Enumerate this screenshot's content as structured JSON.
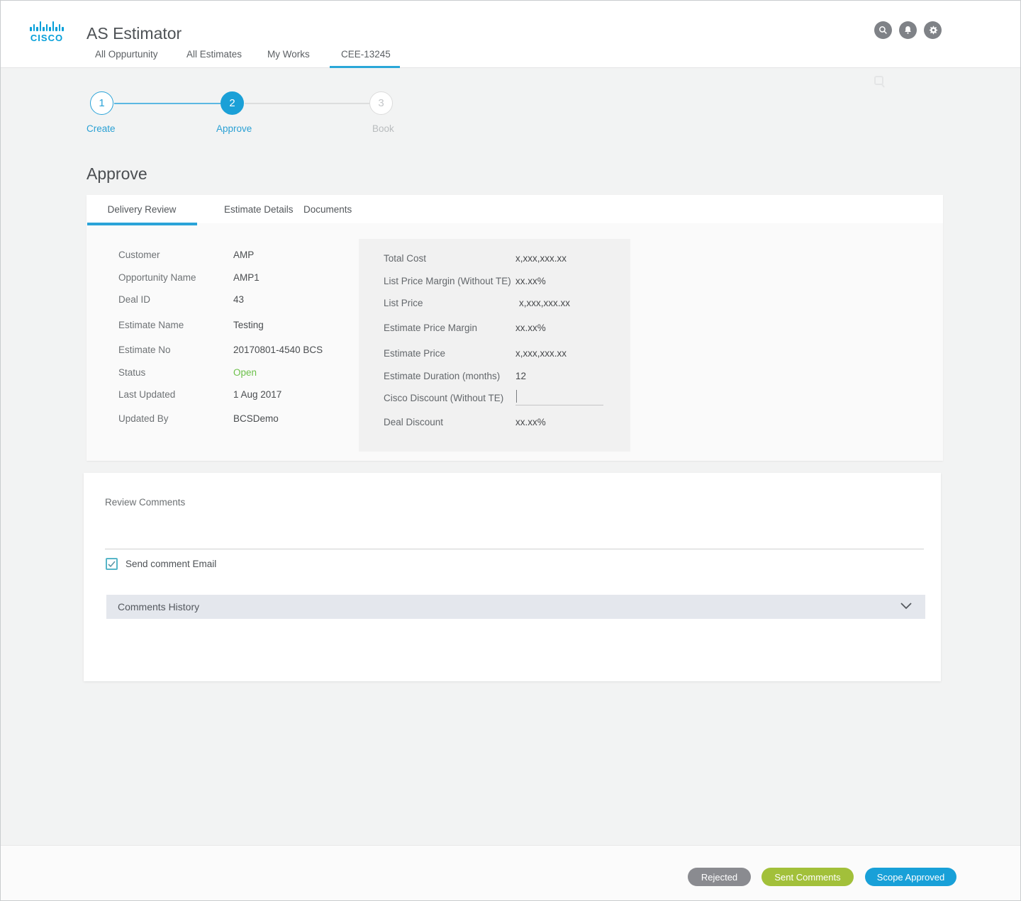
{
  "header": {
    "brand": "CISCO",
    "app_title": "AS Estimator",
    "nav": [
      {
        "label": "All Oppurtunity",
        "active": false
      },
      {
        "label": "All Estimates",
        "active": false
      },
      {
        "label": "My Works",
        "active": false
      },
      {
        "label": "CEE-13245",
        "active": true
      }
    ],
    "icons": [
      "search-icon",
      "bell-icon",
      "gear-icon"
    ]
  },
  "stepper": {
    "steps": [
      {
        "num": "1",
        "label": "Create",
        "state": "done"
      },
      {
        "num": "2",
        "label": "Approve",
        "state": "active"
      },
      {
        "num": "3",
        "label": "Book",
        "state": "upcoming"
      }
    ]
  },
  "page": {
    "title": "Approve"
  },
  "tabs": [
    {
      "label": "Delivery Review",
      "active": true
    },
    {
      "label": "Estimate Details",
      "active": false
    },
    {
      "label": "Documents",
      "active": false
    }
  ],
  "details": {
    "rows": [
      {
        "label": "Customer",
        "value": "AMP"
      },
      {
        "label": "Opportunity Name",
        "value": "AMP1"
      },
      {
        "label": "Deal ID",
        "value": "43"
      },
      {
        "label": "Estimate Name",
        "value": "Testing"
      },
      {
        "label": "Estimate No",
        "value": "20170801-4540 BCS"
      },
      {
        "label": "Status",
        "value": "Open"
      },
      {
        "label": "Last Updated",
        "value": "1 Aug 2017"
      },
      {
        "label": "Updated By",
        "value": "BCSDemo"
      }
    ]
  },
  "pricing": {
    "rows": [
      {
        "label": "Total Cost",
        "value": "x,xxx,xxx.xx"
      },
      {
        "label": "List Price Margin (Without TE)",
        "value": "xx.xx%"
      },
      {
        "label": "List Price",
        "value": "x,xxx,xxx.xx"
      },
      {
        "label": "Estimate Price Margin",
        "value": "xx.xx%"
      },
      {
        "label": "Estimate Price",
        "value": "x,xxx,xxx.xx"
      },
      {
        "label": "Estimate Duration (months)",
        "value": "12"
      },
      {
        "label": "Cisco Discount (Without TE)",
        "value": ""
      },
      {
        "label": "Deal Discount",
        "value": "xx.xx%"
      }
    ],
    "discount_input": {
      "value": "",
      "placeholder": ""
    }
  },
  "comments": {
    "section_label": "Review Comments",
    "comment_value": "",
    "checkbox_label": "Send comment Email",
    "checkbox_checked": true,
    "history_label": "Comments History"
  },
  "footer": {
    "buttons": [
      {
        "label": "Rejected"
      },
      {
        "label": "Sent Comments"
      },
      {
        "label": "Scope Approved"
      }
    ]
  },
  "colors": {
    "accent_blue": "#1ba0d7",
    "cisco_blue": "#049fd9",
    "status_green": "#6cc04a",
    "button_gray": "#8a8b90",
    "button_olive": "#a2c03a",
    "button_blue": "#18a0d8",
    "history_bar": "#e4e7ed",
    "panel_gray": "#f1f1f1"
  }
}
